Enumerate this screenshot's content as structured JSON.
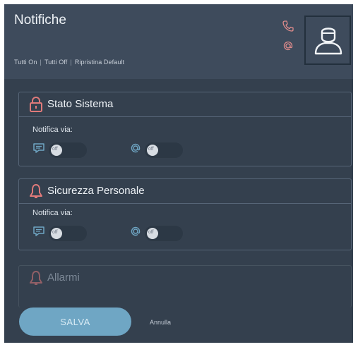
{
  "header": {
    "title": "Notifiche",
    "links": [
      "Tutti On",
      "Tutti Off",
      "Ripristina Default"
    ]
  },
  "icons": {
    "phone": "phone-icon",
    "email": "at-icon",
    "avatar": "user-avatar-icon"
  },
  "colors": {
    "accent": "#6fa6c4",
    "alert": "#e07a7a",
    "background": "#34404e",
    "header": "#3e4b5c"
  },
  "sections": [
    {
      "title": "Stato Sistema",
      "icon": "lock-icon",
      "via_label": "Notifica via:",
      "channels": [
        {
          "icon": "message-icon",
          "state": "off"
        },
        {
          "icon": "at-icon",
          "state": "off"
        }
      ]
    },
    {
      "title": "Sicurezza Personale",
      "icon": "bell-icon",
      "via_label": "Notifica via:",
      "channels": [
        {
          "icon": "message-icon",
          "state": "off"
        },
        {
          "icon": "at-icon",
          "state": "off"
        }
      ]
    },
    {
      "title": "Allarmi",
      "icon": "bell-icon"
    }
  ],
  "footer": {
    "save_label": "SALVA",
    "cancel_label": "Annulla"
  }
}
